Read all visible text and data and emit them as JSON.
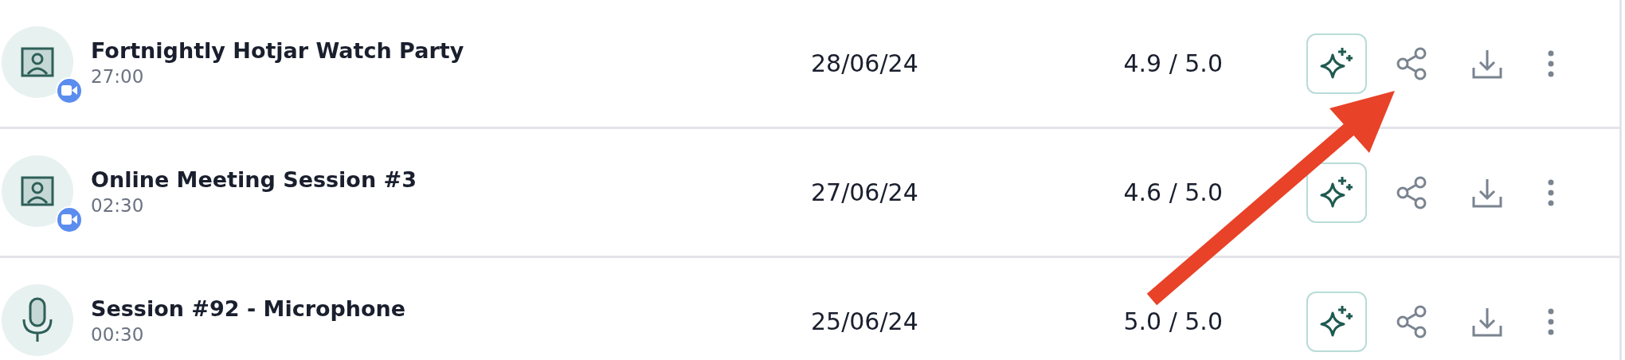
{
  "recordings": [
    {
      "kind": "video",
      "title": "Fortnightly Hotjar Watch Party",
      "duration": "27:00",
      "date": "28/06/24",
      "score": "4.9 / 5.0"
    },
    {
      "kind": "video",
      "title": "Online Meeting Session #3",
      "duration": "02:30",
      "date": "27/06/24",
      "score": "4.6 / 5.0"
    },
    {
      "kind": "audio",
      "title": "Session #92 - Microphone",
      "duration": "00:30",
      "date": "25/06/24",
      "score": "5.0 / 5.0"
    }
  ]
}
